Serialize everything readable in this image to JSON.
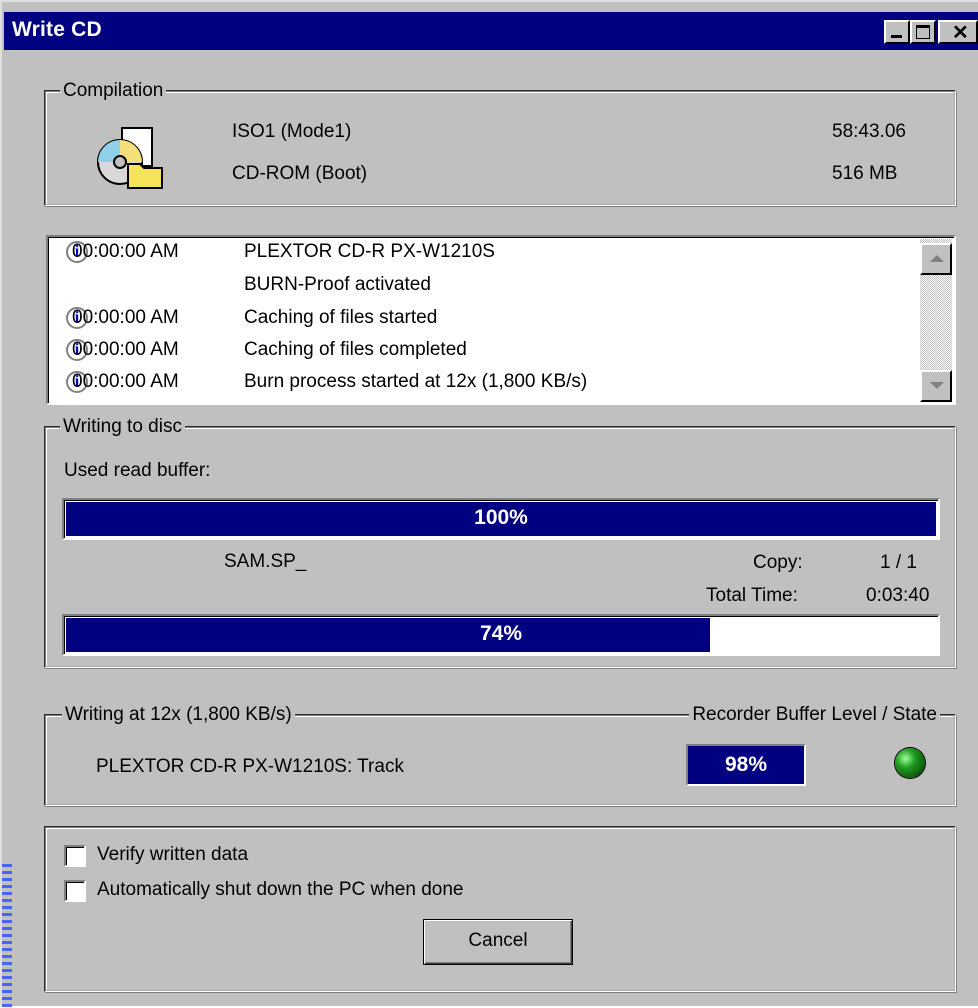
{
  "window": {
    "title": "Write CD"
  },
  "compilation": {
    "legend": "Compilation",
    "name": "ISO1 (Mode1)",
    "type": "CD-ROM (Boot)",
    "duration": "58:43.06",
    "size": "516 MB",
    "icon": "cd-compilation-icon"
  },
  "log": {
    "entries": [
      {
        "time": "00:00:00 AM",
        "message": "PLEXTOR CD-R   PX-W1210S",
        "icon": "info-icon"
      },
      {
        "time": "",
        "message": "BURN-Proof activated",
        "icon": ""
      },
      {
        "time": "00:00:00 AM",
        "message": "Caching of files started",
        "icon": "info-icon"
      },
      {
        "time": "00:00:00 AM",
        "message": "Caching of files completed",
        "icon": "info-icon"
      },
      {
        "time": "00:00:00 AM",
        "message": "Burn process started at 12x (1,800 KB/s)",
        "icon": "info-icon"
      }
    ]
  },
  "writing": {
    "legend": "Writing to disc",
    "buffer_label": "Used read buffer:",
    "buffer_percent_text": "100%",
    "buffer_fraction": 1.0,
    "file_name": "SAM.SP_",
    "copy_label": "Copy:",
    "copy_value": "1 / 1",
    "total_time_label": "Total Time:",
    "total_time_value": "0:03:40",
    "progress_percent_text": "74%",
    "progress_fraction": 0.74
  },
  "recorder": {
    "legend": "Writing at 12x (1,800 KB/s)",
    "state_legend": "Recorder Buffer Level / State",
    "device_track": "PLEXTOR CD-R   PX-W1210S:  Track",
    "buffer_level_text": "98%",
    "state_color": "#1f9a1f"
  },
  "options": {
    "verify_label": "Verify written data",
    "verify_checked": false,
    "shutdown_label": "Automatically shut down the PC when done",
    "shutdown_checked": false
  },
  "actions": {
    "cancel_label": "Cancel"
  },
  "colors": {
    "titlebar": "#000080",
    "progress": "#000080",
    "face": "#c0c0c0"
  }
}
